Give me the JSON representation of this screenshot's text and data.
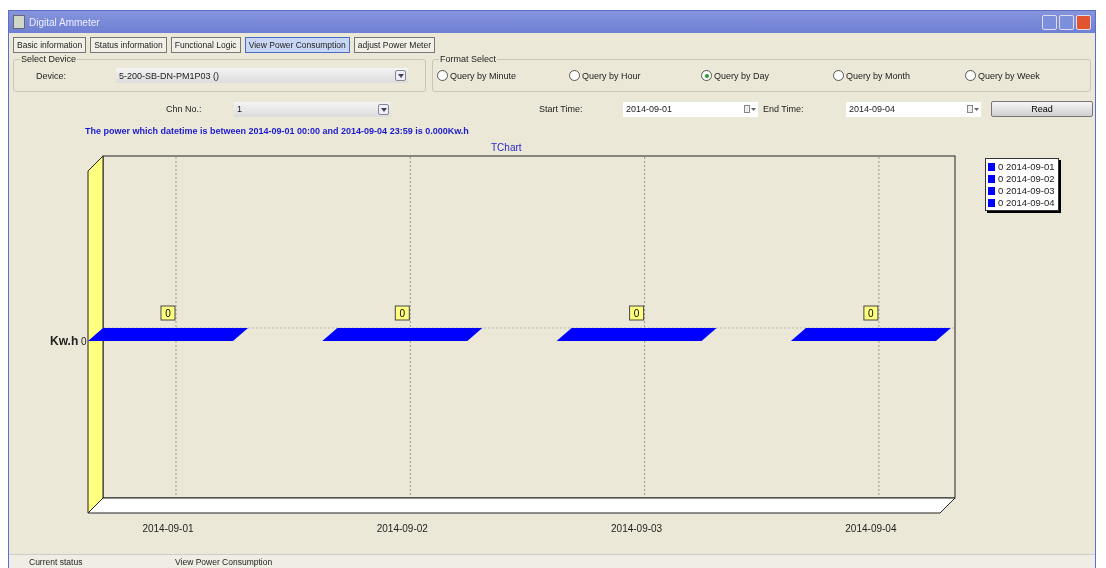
{
  "window": {
    "title": "Digital Ammeter"
  },
  "tabs": [
    {
      "label": "Basic information",
      "selected": false
    },
    {
      "label": "Status information",
      "selected": false
    },
    {
      "label": "Functional Logic",
      "selected": false
    },
    {
      "label": "View Power Consumption",
      "selected": true
    },
    {
      "label": "adjust Power Meter",
      "selected": false
    }
  ],
  "select_device": {
    "title": "Select Device",
    "device_label": "Device:",
    "device_value": "5-200-SB-DN-PM1P03 ()"
  },
  "format_select": {
    "title": "Format Select",
    "options": [
      {
        "label": "Query by Minute",
        "selected": false
      },
      {
        "label": "Query by Hour",
        "selected": false
      },
      {
        "label": "Query by Day",
        "selected": true
      },
      {
        "label": "Query by Month",
        "selected": false
      },
      {
        "label": "Query by Week",
        "selected": false
      }
    ]
  },
  "query": {
    "chn_label": "Chn No.:",
    "chn_value": "1",
    "start_label": "Start Time:",
    "start_value": "2014-09-01",
    "end_label": "End Time:",
    "end_value": "2014-09-04",
    "read_button": "Read"
  },
  "message": "The power which datetime is between 2014-09-01 00:00 and 2014-09-04 23:59 is 0.000Kw.h",
  "chart": {
    "title": "TChart",
    "y_axis_label": "Kw.h",
    "y_tick_label": "0",
    "categories": [
      "2014-09-01",
      "2014-09-02",
      "2014-09-03",
      "2014-09-04"
    ],
    "value_labels": [
      "0",
      "0",
      "0",
      "0"
    ],
    "legend": [
      "0 2014-09-01",
      "0 2014-09-02",
      "0 2014-09-03",
      "0 2014-09-04"
    ]
  },
  "status_bar": [
    "Current status",
    "View Power Consumption"
  ]
}
